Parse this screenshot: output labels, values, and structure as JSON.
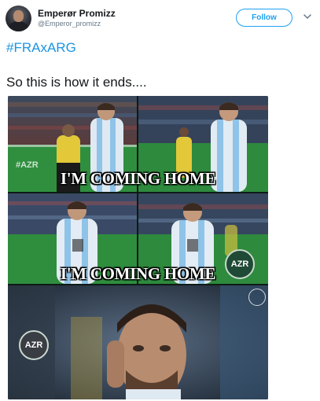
{
  "tweet": {
    "display_name": "Emperør Promizz",
    "handle": "@Emperor_promizz",
    "follow_label": "Follow",
    "hashtag": "#FRAxARG",
    "text": "So this is how it ends...."
  },
  "media": {
    "overlay_top": "I'M COMING HOME",
    "overlay_bottom": "I'M COMING HOME",
    "watermark": "#AZR",
    "badge_text": "AZR"
  },
  "colors": {
    "link": "#1b95e0",
    "follow_border": "#1da1f2",
    "secondary_text": "#657786"
  }
}
